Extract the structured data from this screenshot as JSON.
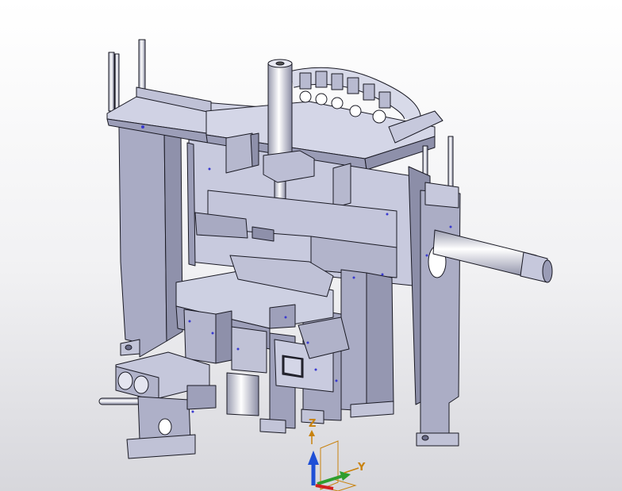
{
  "viewport": {
    "background_top": "#ffffff",
    "background_bottom": "#d7d7dc"
  },
  "model": {
    "metal_light": "#cfd1e3",
    "metal_mid": "#aeb0c8",
    "metal_dark": "#8c8ea8",
    "edge": "#1a1a24",
    "hole_marks": "#3a3ad0"
  },
  "compass": {
    "z_label": "Z",
    "y_label": "Y",
    "z_color": "#1e4fd6",
    "y_color": "#2e9e2e",
    "x_color": "#d22020",
    "label_color": "#c8820e"
  }
}
